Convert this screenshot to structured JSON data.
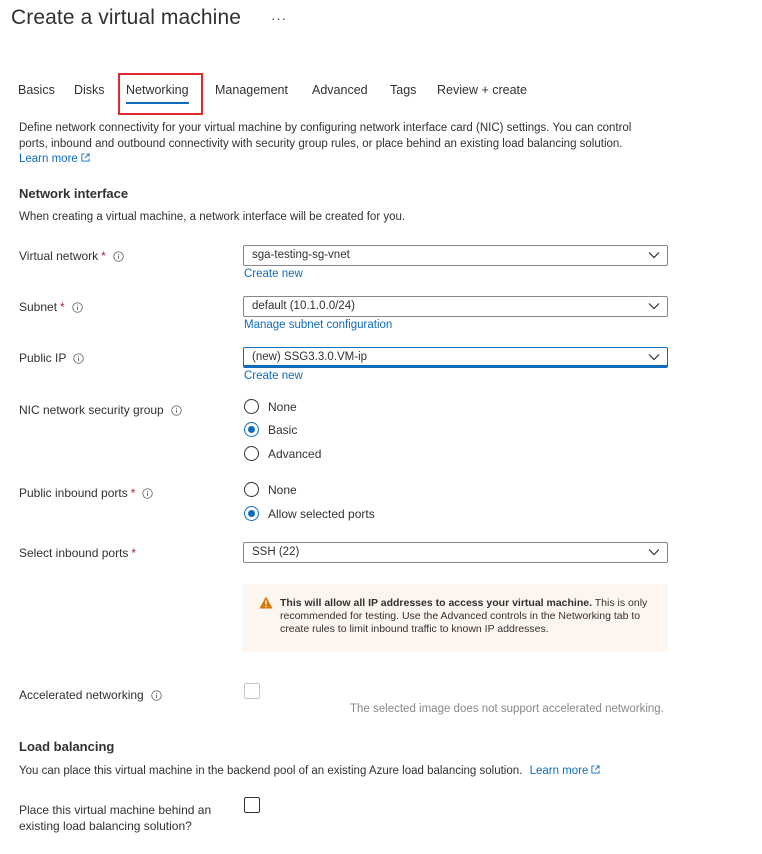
{
  "page": {
    "title": "Create a virtual machine",
    "more": "···"
  },
  "tabs": [
    {
      "label": "Basics"
    },
    {
      "label": "Disks"
    },
    {
      "label": "Networking",
      "active": true
    },
    {
      "label": "Management"
    },
    {
      "label": "Advanced"
    },
    {
      "label": "Tags"
    },
    {
      "label": "Review + create"
    }
  ],
  "intro": {
    "text": "Define network connectivity for your virtual machine by configuring network interface card (NIC) settings. You can control ports, inbound and outbound connectivity with security group rules, or place behind an existing load balancing solution.",
    "learn_more": "Learn more"
  },
  "network_interface": {
    "heading": "Network interface",
    "description": "When creating a virtual machine, a network interface will be created for you.",
    "virtual_network": {
      "label": "Virtual network",
      "required": "*",
      "value": "sga-testing-sg-vnet",
      "link": "Create new"
    },
    "subnet": {
      "label": "Subnet",
      "required": "*",
      "value": "default (10.1.0.0/24)",
      "link": "Manage subnet configuration"
    },
    "public_ip": {
      "label": "Public IP",
      "value": "(new) SSG3.3.0.VM-ip",
      "link": "Create new"
    },
    "nic_nsg": {
      "label": "NIC network security group",
      "options": [
        "None",
        "Basic",
        "Advanced"
      ],
      "selected": "Basic"
    },
    "public_inbound_ports": {
      "label": "Public inbound ports",
      "required": "*",
      "options": [
        "None",
        "Allow selected ports"
      ],
      "selected": "Allow selected ports"
    },
    "select_inbound_ports": {
      "label": "Select inbound ports",
      "required": "*",
      "value": "SSH (22)"
    },
    "warning": {
      "bold": "This will allow all IP addresses to access your virtual machine.",
      "text": " This is only recommended for testing.  Use the Advanced controls in the Networking tab to create rules to limit inbound traffic to known IP addresses."
    },
    "accelerated_networking": {
      "label": "Accelerated networking",
      "checked": false,
      "note": "The selected image does not support accelerated networking."
    }
  },
  "load_balancing": {
    "heading": "Load balancing",
    "description": "You can place this virtual machine in the backend pool of an existing Azure load balancing solution.",
    "learn_more": "Learn more",
    "place_behind": {
      "label_line1": "Place this virtual machine behind an",
      "label_line2": "existing load balancing solution?",
      "checked": false
    }
  },
  "colors": {
    "accent": "#0f6cbd",
    "required": "#a4262c",
    "highlight": "#e0282e",
    "warning": "#d97706"
  }
}
